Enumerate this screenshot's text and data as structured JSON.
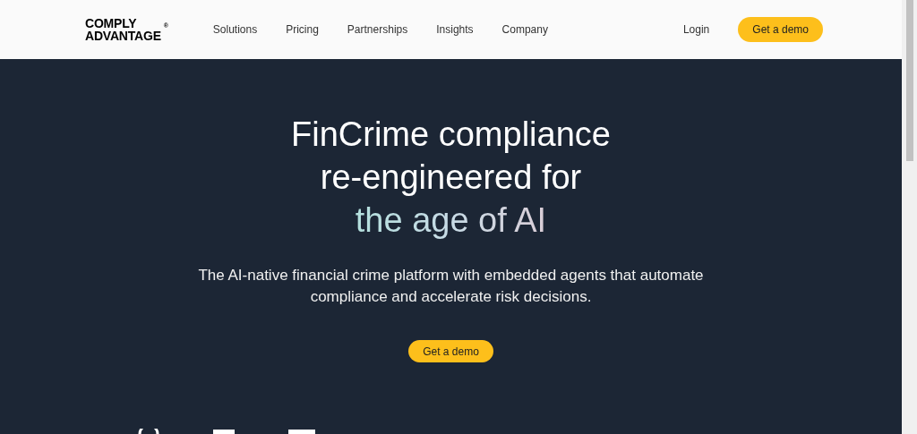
{
  "header": {
    "logo": [
      "COMPLY",
      "ADVANTAGE"
    ],
    "logo_mark": "®",
    "nav": [
      "Solutions",
      "Pricing",
      "Partnerships",
      "Insights",
      "Company"
    ],
    "login": "Login",
    "cta": "Get a demo"
  },
  "hero": {
    "title_lines": [
      "FinCrime compliance",
      "re-engineered for"
    ],
    "title_highlight": "the age of AI",
    "subtitle": "The AI-native financial crime platform with embedded agents that automate compliance and accelerate risk decisions.",
    "cta": "Get a demo"
  }
}
